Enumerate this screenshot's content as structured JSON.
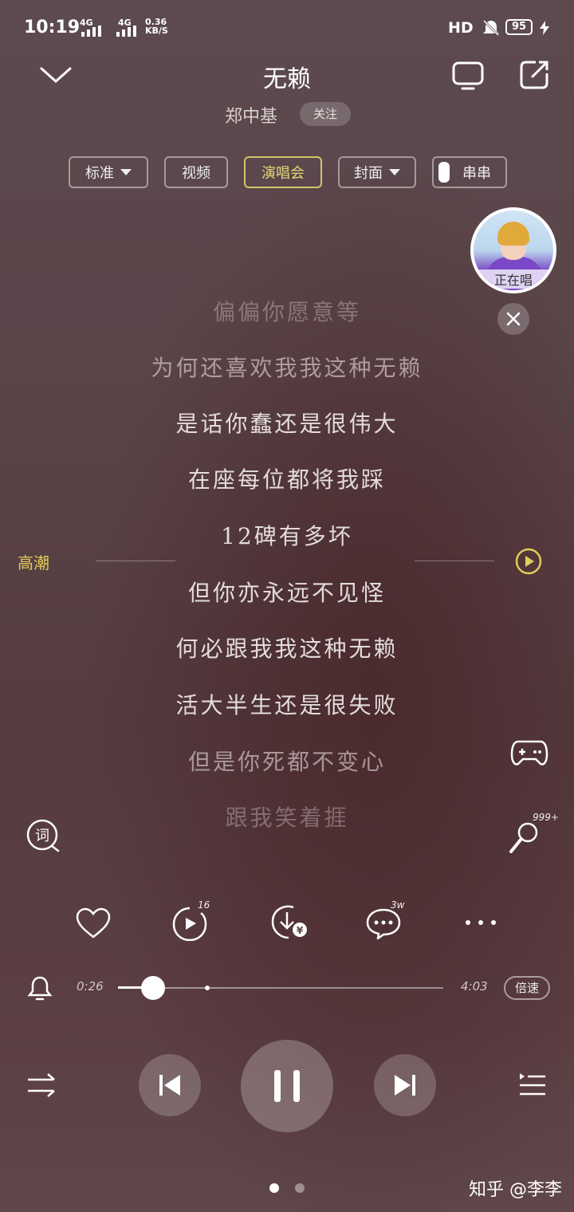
{
  "status_bar": {
    "time": "10:19",
    "network1": "4G",
    "network2": "4G",
    "speed_value": "0.36",
    "speed_unit": "KB/S",
    "hd": "HD",
    "battery": "95"
  },
  "header": {
    "title": "无赖",
    "artist": "郑中基",
    "follow_label": "关注"
  },
  "chips": {
    "quality": "标准",
    "video": "视频",
    "concert": "演唱会",
    "cover": "封面",
    "chuanchuan": "串串"
  },
  "singer_bubble": {
    "label": "正在唱"
  },
  "lyrics": [
    "偏偏你愿意等",
    "为何还喜欢我我这种无赖",
    "是话你蠢还是很伟大",
    "在座每位都将我踩",
    "12碑有多坏",
    "但你亦永远不见怪",
    "何必跟我我这种无赖",
    "活大半生还是很失败",
    "但是你死都不变心",
    "跟我笑着捱"
  ],
  "climax_label": "高潮",
  "mic_count": "999+",
  "actions": {
    "video_count": "16",
    "comment_count": "3w"
  },
  "progress": {
    "current": "0:26",
    "total": "4:03",
    "fraction": 0.107,
    "speed_label": "倍速"
  },
  "watermark": "知乎 @李李",
  "colors": {
    "accent_yellow": "#e2cc5a",
    "background": "#5a4549"
  }
}
